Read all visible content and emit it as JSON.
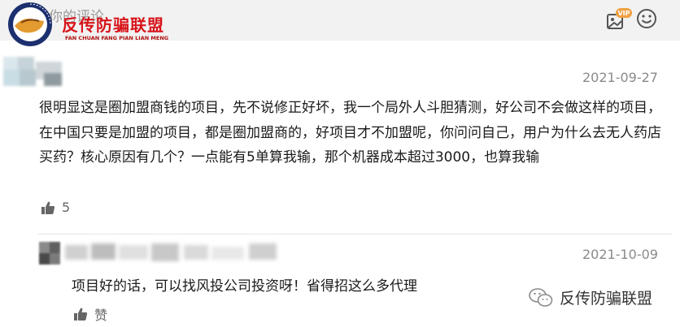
{
  "input": {
    "placeholder": "你的评论"
  },
  "logo": {
    "title": "反传防骗联盟",
    "subtitle": "FAN CHUAN FANG PIAN LIAN MENG"
  },
  "toolbar": {
    "vip_badge": "VIP",
    "image_icon": "image-icon",
    "emoji_icon": "emoji-icon"
  },
  "comments": [
    {
      "date": "2021-09-27",
      "text": "很明显这是圈加盟商钱的项目，先不说修正好坏，我一个局外人斗胆猜测，好公司不会做这样的项目，在中国只要是加盟的项目，都是圈加盟商的，好项目才不加盟呢，你问问自己，用户为什么去无人药店买药？核心原因有几个？一点能有5单算我输，那个机器成本超过3000，也算我输",
      "likes": "5"
    }
  ],
  "reply": {
    "date": "2021-10-09",
    "text": "项目好的话，可以找风投公司投资呀！省得招这么多代理",
    "like_label": "赞"
  },
  "watermark": {
    "text": "反传防骗联盟"
  },
  "colors": {
    "brand_red": "#d8141b",
    "bar_bg": "#f2f2f2",
    "vip_orange": "#f0a040"
  }
}
